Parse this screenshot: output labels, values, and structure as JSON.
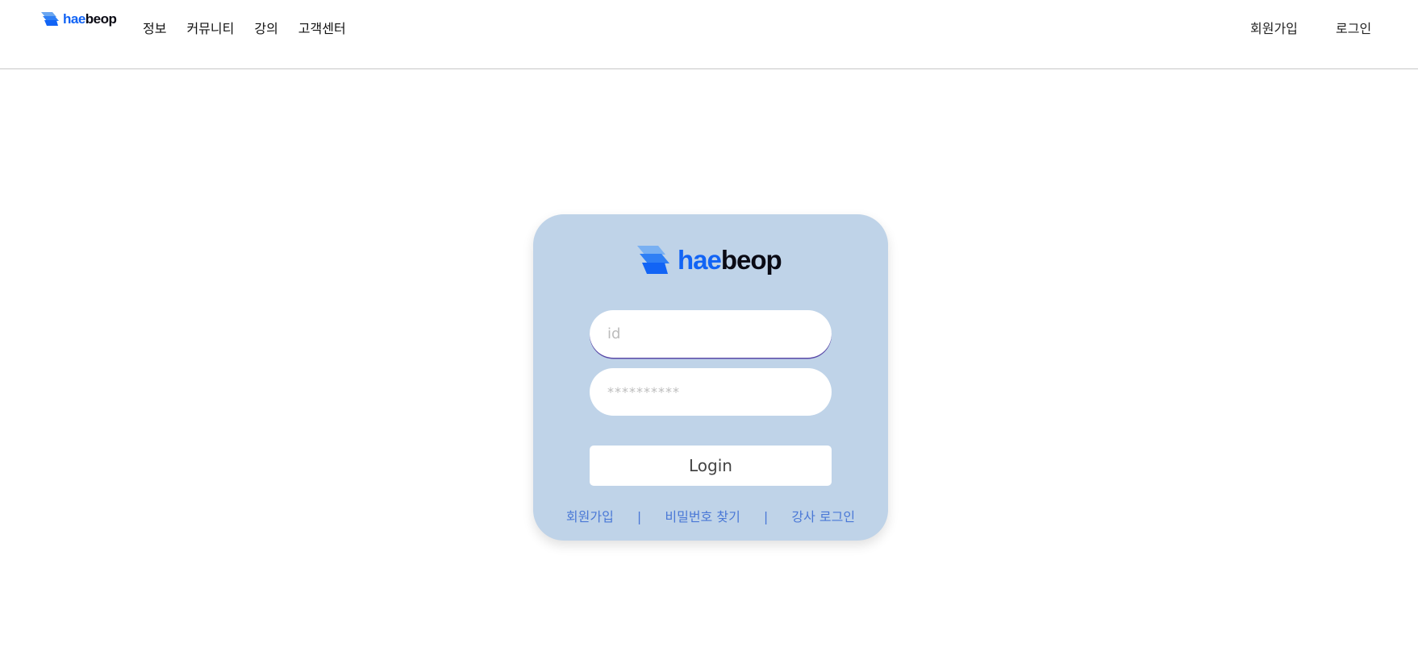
{
  "brand": {
    "part1": "hae",
    "part2": "beop",
    "icon": "stacked-layers-logo-icon"
  },
  "nav": {
    "items": [
      {
        "label": "정보"
      },
      {
        "label": "커뮤니티"
      },
      {
        "label": "강의"
      },
      {
        "label": "고객센터"
      }
    ],
    "signup": "회원가입",
    "login": "로그인"
  },
  "login_card": {
    "id_placeholder": "id",
    "password_placeholder": "**********",
    "login_button": "Login",
    "links": {
      "signup": "회원가입",
      "separator": "|",
      "find_password": "비밀번호 찾기",
      "instructor_login": "강사 로그인"
    }
  },
  "colors": {
    "brand_blue": "#1264f5",
    "card_bg": "#bfd3e8",
    "link": "#4a78d6"
  }
}
